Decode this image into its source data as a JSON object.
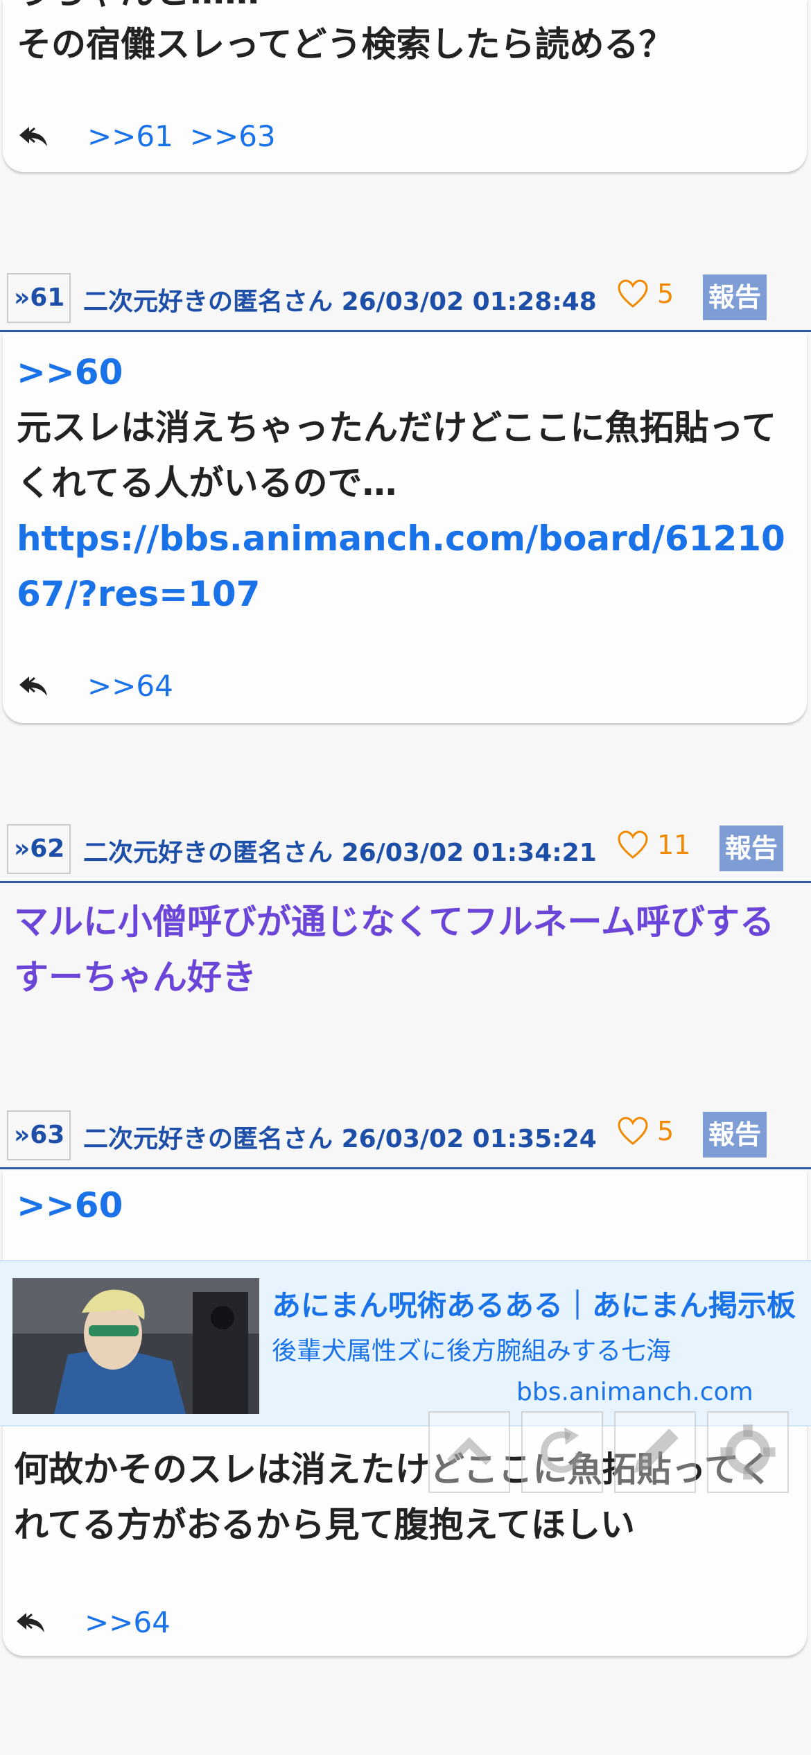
{
  "top_post": {
    "partial_line": "うちゃんと……",
    "body": "その宿儺スレってどう検索したら読める？",
    "replies": [
      ">>61",
      ">>63"
    ]
  },
  "posts": [
    {
      "number": "»61",
      "poster": "二次元好きの匿名さん",
      "datetime": "26/03/02 01:28:48",
      "likes": "5",
      "report": "報告",
      "anchor": ">>60",
      "body": "元スレは消えちゃったんだけどここに魚拓貼ってくれてる人がいるので…",
      "link": "https://bbs.animanch.com/board/6121067/?res=107",
      "replies": [
        ">>64"
      ]
    },
    {
      "number": "»62",
      "poster": "二次元好きの匿名さん",
      "datetime": "26/03/02 01:34:21",
      "likes": "11",
      "report": "報告",
      "body": "マルに小僧呼びが通じなくてフルネーム呼びするすーちゃん好き"
    },
    {
      "number": "»63",
      "poster": "二次元好きの匿名さん",
      "datetime": "26/03/02 01:35:24",
      "likes": "5",
      "report": "報告",
      "anchor": ">>60",
      "link_card": {
        "title": "あにまん呪術あるある｜あにまん掲示板",
        "description": "後輩犬属性ズに後方腕組みする七海",
        "domain": "bbs.animanch.com"
      },
      "body": "何故かそのスレは消えたけどここに魚拓貼ってくれてる方がおるから見て腹抱えてほしい",
      "replies": [
        ">>64"
      ]
    }
  ],
  "colors": {
    "link": "#1a72e8",
    "header": "#1d4fa8",
    "like": "#f08a00",
    "report_bg": "#7e9dd4",
    "purple": "#6b45d8"
  },
  "floating_buttons": [
    "chevron-up-icon",
    "refresh-icon",
    "edit-icon",
    "gear-icon"
  ]
}
